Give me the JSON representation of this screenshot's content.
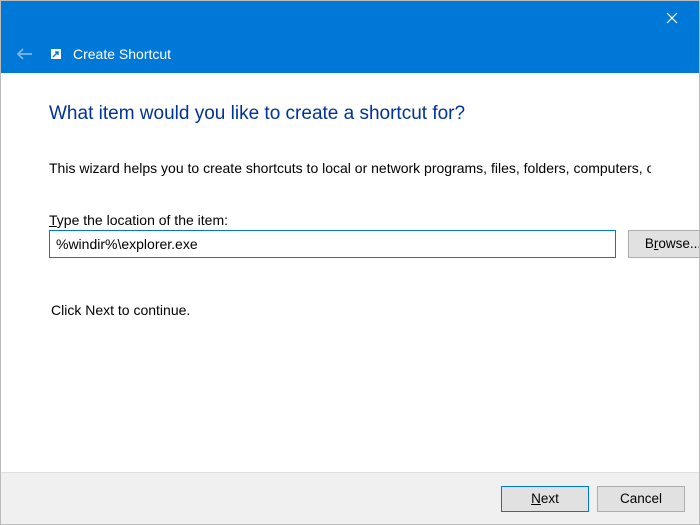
{
  "window": {
    "title": "Create Shortcut"
  },
  "content": {
    "heading": "What item would you like to create a shortcut for?",
    "description": "This wizard helps you to create shortcuts to local or network programs, files, folders, computers, or Internet addresses.",
    "locationLabelPrefix": "T",
    "locationLabelRest": "ype the location of the item:",
    "locationValue": "%windir%\\explorer.exe",
    "browsePrefix": "B",
    "browseAccel": "r",
    "browseRest": "owse...",
    "continueText": "Click Next to continue."
  },
  "footer": {
    "nextAccel": "N",
    "nextRest": "ext",
    "cancel": "Cancel"
  }
}
